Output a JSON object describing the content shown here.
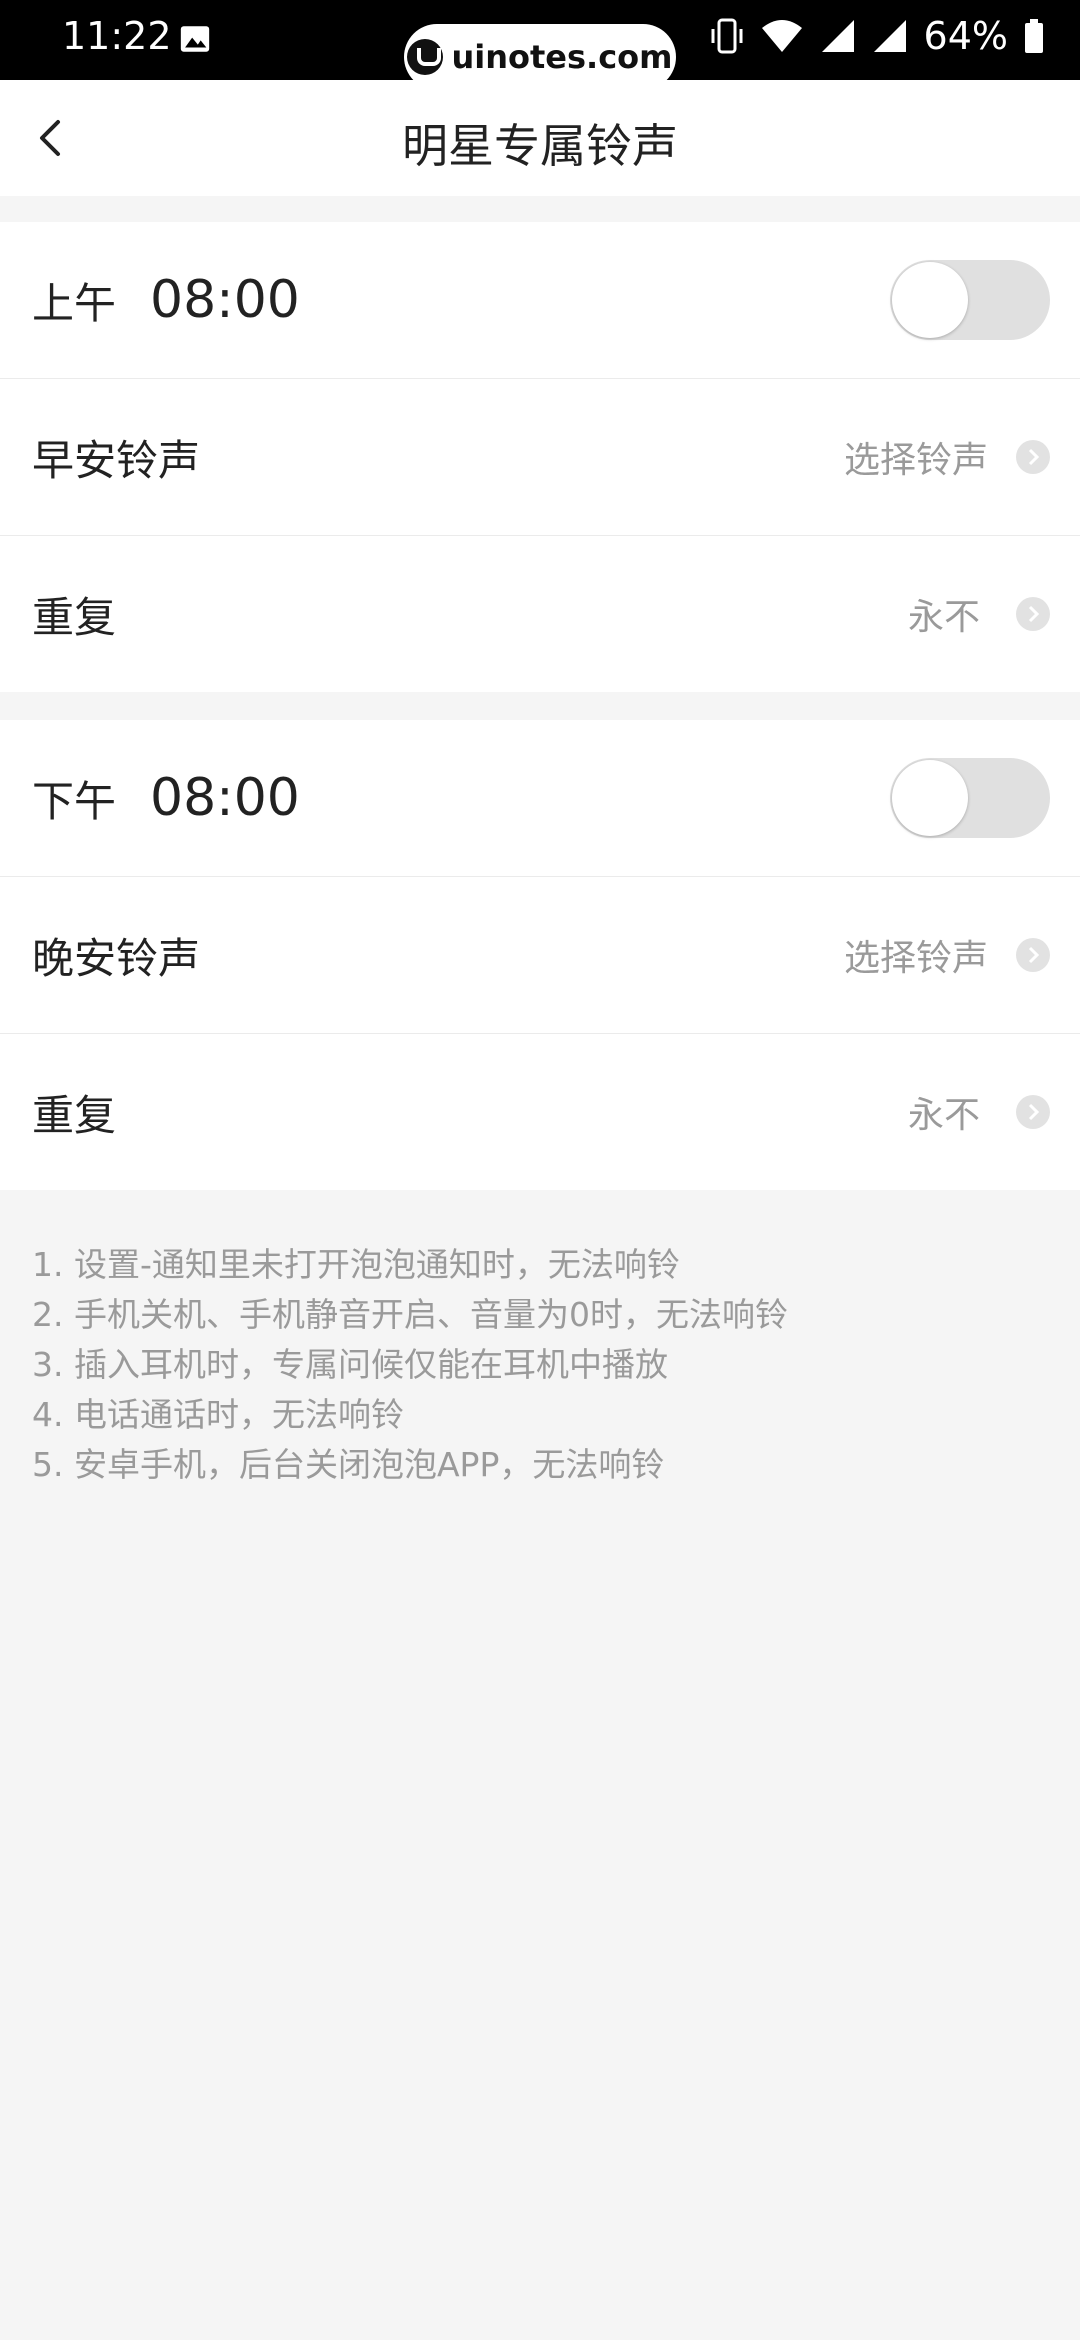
{
  "status_bar": {
    "time": "11:22",
    "battery": "64%",
    "watermark": "uinotes.com",
    "icons": [
      "gallery-icon",
      "vibrate-icon",
      "wifi-icon",
      "signal-icon",
      "battery-icon"
    ]
  },
  "header": {
    "title": "明星专属铃声",
    "back_icon": "back-arrow-icon"
  },
  "morning": {
    "period": "上午",
    "time": "08:00",
    "enabled": false,
    "ringtone_label": "早安铃声",
    "ringtone_value": "选择铃声",
    "repeat_label": "重复",
    "repeat_value": "永不"
  },
  "evening": {
    "period": "下午",
    "time": "08:00",
    "enabled": false,
    "ringtone_label": "晚安铃声",
    "ringtone_value": "选择铃声",
    "repeat_label": "重复",
    "repeat_value": "永不"
  },
  "notes": [
    "1. 设置-通知里未打开泡泡通知时，无法响铃",
    "2. 手机关机、手机静音开启、音量为0时，无法响铃",
    "3. 插入耳机时，专属问候仅能在耳机中播放",
    "4. 电话通话时，无法响铃",
    "5. 安卓手机，后台关闭泡泡APP，无法响铃"
  ],
  "colors": {
    "background": "#f5f5f5",
    "card": "#ffffff",
    "text_primary": "#222222",
    "text_secondary": "#9a9a9a",
    "toggle_off": "#e0e0e0"
  }
}
